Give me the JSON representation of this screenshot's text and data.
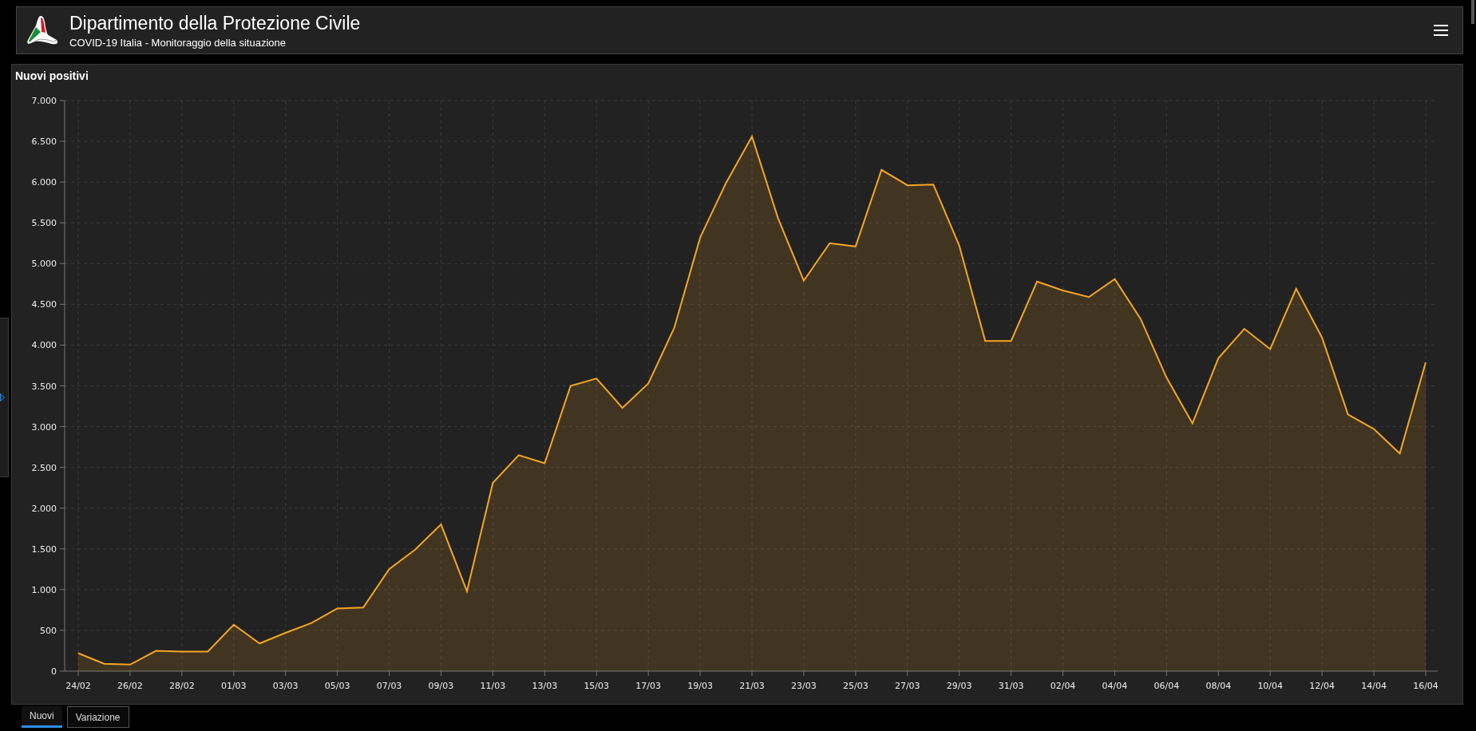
{
  "header": {
    "title": "Dipartimento della Protezione Civile",
    "subtitle": "COVID-19 Italia - Monitoraggio della situazione"
  },
  "panel": {
    "title": "Nuovi positivi",
    "chart_data": {
      "type": "area",
      "categories": [
        "24/02",
        null,
        "26/02",
        null,
        "28/02",
        null,
        "01/03",
        null,
        "03/03",
        null,
        "05/03",
        null,
        "07/03",
        null,
        "09/03",
        null,
        "11/03",
        null,
        "13/03",
        null,
        "15/03",
        null,
        "17/03",
        null,
        "19/03",
        null,
        "21/03",
        null,
        "23/03",
        null,
        "25/03",
        null,
        "27/03",
        null,
        "29/03",
        null,
        "31/03",
        null,
        "02/04",
        null,
        "04/04",
        null,
        "06/04",
        null,
        "08/04",
        null,
        "10/04",
        null,
        "12/04",
        null,
        "14/04",
        null,
        "16/04"
      ],
      "series": [
        {
          "color": "#f5a623",
          "values": [
            220,
            90,
            80,
            250,
            240,
            240,
            570,
            340,
            470,
            590,
            770,
            780,
            1250,
            1490,
            1800,
            980,
            2310,
            2650,
            2550,
            3500,
            3590,
            3230,
            3530,
            4210,
            5320,
            5990,
            6560,
            5560,
            4790,
            5250,
            5210,
            6150,
            5960,
            5970,
            5220,
            4050,
            4050,
            4780,
            4670,
            4590,
            4810,
            4320,
            3600,
            3040,
            3840,
            4200,
            3950,
            4690,
            4090,
            3150,
            2970,
            2670,
            3790
          ]
        }
      ],
      "ylim": [
        0,
        7000
      ],
      "grid": true,
      "yticks": [
        {
          "value": 0,
          "label": "0"
        },
        {
          "value": 500,
          "label": "500"
        },
        {
          "value": 1000,
          "label": "1.000"
        },
        {
          "value": 1500,
          "label": "1.500"
        },
        {
          "value": 2000,
          "label": "2.000"
        },
        {
          "value": 2500,
          "label": "2.500"
        },
        {
          "value": 3000,
          "label": "3.000"
        },
        {
          "value": 3500,
          "label": "3.500"
        },
        {
          "value": 4000,
          "label": "4.000"
        },
        {
          "value": 4500,
          "label": "4.500"
        },
        {
          "value": 5000,
          "label": "5.000"
        },
        {
          "value": 5500,
          "label": "5.500"
        },
        {
          "value": 6000,
          "label": "6.000"
        },
        {
          "value": 6500,
          "label": "6.500"
        },
        {
          "value": 7000,
          "label": "7.000"
        }
      ]
    }
  },
  "tabs": [
    {
      "label": "Nuovi",
      "selected": true
    },
    {
      "label": "Variazione",
      "selected": false
    }
  ]
}
